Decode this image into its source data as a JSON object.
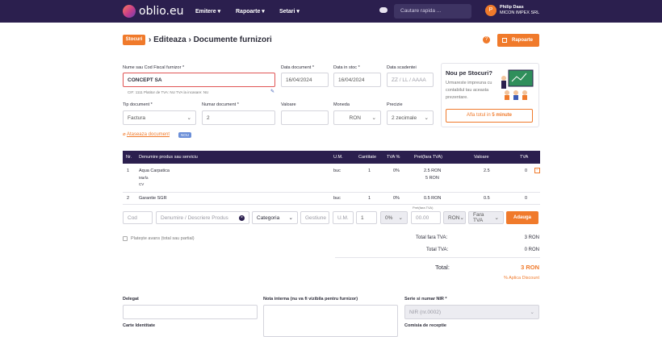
{
  "topbar": {
    "logo": "oblio.eu",
    "nav": [
      "Emitere",
      "Rapoarte",
      "Setari"
    ],
    "search_placeholder": "Cautare rapida ...",
    "user_initial": "P",
    "user_name": "Philip Daas",
    "company": "MICON IMPEX SRL"
  },
  "header": {
    "badge": "Stocuri",
    "title": "Editeaza",
    "subtitle": "Documente furnizori",
    "reports_button": "Rapoarte"
  },
  "form": {
    "supplier_label": "Nume sau Cod Fiscal furnizor *",
    "supplier_value": "CONCEPT SA",
    "supplier_meta": "CIF: 1111   Platitor de TVA: NU   TVA la incasare: NU",
    "doc_date_label": "Data document *",
    "doc_date_value": "16/04/2024",
    "stock_date_label": "Data in stoc *",
    "stock_date_value": "16/04/2024",
    "due_date_label": "Data scadentei",
    "due_date_placeholder": "ZZ / LL / AAAA",
    "doc_type_label": "Tip document *",
    "doc_type_value": "Factura",
    "doc_number_label": "Numar document *",
    "doc_number_value": "2",
    "value_label": "Valoare",
    "value_value": "",
    "currency_label": "Moneda",
    "currency_value": "RON",
    "precision_label": "Precizie",
    "precision_value": "2 zecimale",
    "attach_label": "Ataseaza document",
    "attach_badge": "NOU"
  },
  "promo": {
    "title": "Nou pe Stocuri?",
    "text": "Urmareste impreuna cu contabilul tau aceasta prezentare.",
    "button_prefix": "Afla totul in ",
    "button_bold": "5 minute"
  },
  "table": {
    "headers": [
      "Nr.",
      "Denumire produs sau serviciu",
      "U.M.",
      "Cantitate",
      "TVA %",
      "Pret(fara TVA)",
      "Valoare",
      "TVA"
    ],
    "rows": [
      {
        "nr": "1",
        "name": "Aqua Carpatica",
        "extra1": "Marfa",
        "extra2": "CV",
        "um": "buc",
        "qty": "1",
        "vat": "0%",
        "price": "2.5 RON",
        "price2": "5 RON",
        "value": "2.5",
        "tva": "0"
      },
      {
        "nr": "2",
        "name": "Garantie SGR",
        "um": "buc",
        "qty": "1",
        "vat": "0%",
        "price": "0.5 RON",
        "value": "0.5",
        "tva": "0"
      }
    ]
  },
  "add_row": {
    "code": "Cod",
    "name": "Denumire / Descriere Produs",
    "category": "Categoria",
    "storage": "Gestiune",
    "um": "U.M.",
    "qty": "1",
    "vat": "0%",
    "price_label": "Pret(fara TVA)",
    "price": "00.00",
    "currency": "RON",
    "tax": "Fara TVA",
    "add_button": "Adauga"
  },
  "totals": {
    "advance_label": "Platește avans (total sau partial)",
    "no_vat_label": "Total fara TVA:",
    "no_vat_value": "3 RON",
    "vat_label": "Total TVA:",
    "vat_value": "0 RON",
    "total_label": "Total:",
    "total_value": "3 RON",
    "discount": "% Aplica Discount"
  },
  "bottom": {
    "delegate": "Delegat",
    "internal_note": "Nota interna (nu va fi vizibila pentru furnizor)",
    "series_label": "Serie si numar NIR *",
    "series_value": "NIR (nr.0002)",
    "id_card": "Carte Identitate",
    "committee": "Comisia de receptie"
  }
}
